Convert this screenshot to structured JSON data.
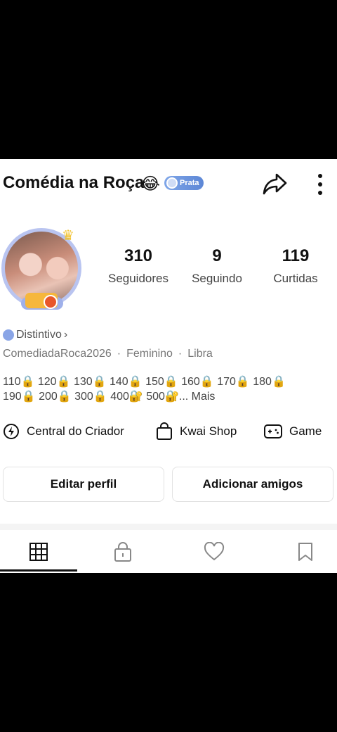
{
  "profile": {
    "title": "Comédia na Roça",
    "title_emoji": "😂",
    "badge_label": "Prata",
    "badge_color": "#6a92dc",
    "handle": "ComediadaRoca2026",
    "gender": "Feminino",
    "sign": "Libra",
    "distintivo_label": "Distintivo",
    "distintivo_chevron": "›"
  },
  "stats": [
    {
      "value": "310",
      "label": "Seguidores"
    },
    {
      "value": "9",
      "label": "Seguindo"
    },
    {
      "value": "119",
      "label": "Curtidas"
    }
  ],
  "levels": {
    "line1": "110🔒 120🔒 130🔒 140🔒 150🔒 160🔒 170🔒 180🔒",
    "line2": "190🔒 200🔒 300🔒 400🔐 500🔐... Mais"
  },
  "actions": {
    "creator": "Central do Criador",
    "shop": "Kwai Shop",
    "game": "Game"
  },
  "buttons": {
    "edit": "Editar perfil",
    "add_friends": "Adicionar amigos"
  },
  "tabs": [
    {
      "icon": "grid-icon",
      "active": true
    },
    {
      "icon": "lock-icon",
      "active": false
    },
    {
      "icon": "heart-icon",
      "active": false
    },
    {
      "icon": "bookmark-icon",
      "active": false
    }
  ],
  "icons": {
    "share": "share-arrow-icon",
    "more": "more-vertical-icon",
    "crown": "crown-icon",
    "camera": "camera-icon"
  }
}
